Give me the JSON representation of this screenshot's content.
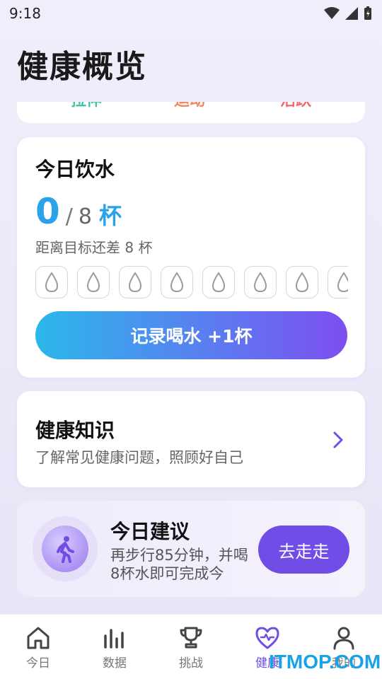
{
  "status": {
    "time": "9:18"
  },
  "page_title": "健康概览",
  "top_card": {
    "labels": [
      {
        "text": "拉伸",
        "color": "#3cc6a5"
      },
      {
        "text": "运动",
        "color": "#f08a5d"
      },
      {
        "text": "活跃",
        "color": "#f06a6a"
      }
    ]
  },
  "water": {
    "title": "今日饮水",
    "current": "0",
    "separator": "/",
    "goal": "8",
    "unit": "杯",
    "hint": "距离目标还差 8 杯",
    "cups_total": 8,
    "record_button": "记录喝水 +1杯"
  },
  "knowledge": {
    "title": "健康知识",
    "subtitle": "了解常见健康问题，照顾好自己"
  },
  "advice": {
    "title": "今日建议",
    "text": "再步行85分钟，并喝8杯水即可完成今",
    "button": "去走走"
  },
  "tabs": [
    {
      "label": "今日",
      "icon": "home-icon",
      "active": false
    },
    {
      "label": "数据",
      "icon": "bar-chart-icon",
      "active": false
    },
    {
      "label": "挑战",
      "icon": "trophy-icon",
      "active": false
    },
    {
      "label": "健康",
      "icon": "heart-pulse-icon",
      "active": true
    },
    {
      "label": "我的",
      "icon": "person-icon",
      "active": false
    }
  ],
  "watermark": "ITMOP.COM",
  "colors": {
    "accent": "#6f4de6",
    "water_blue": "#2aa3ea"
  }
}
